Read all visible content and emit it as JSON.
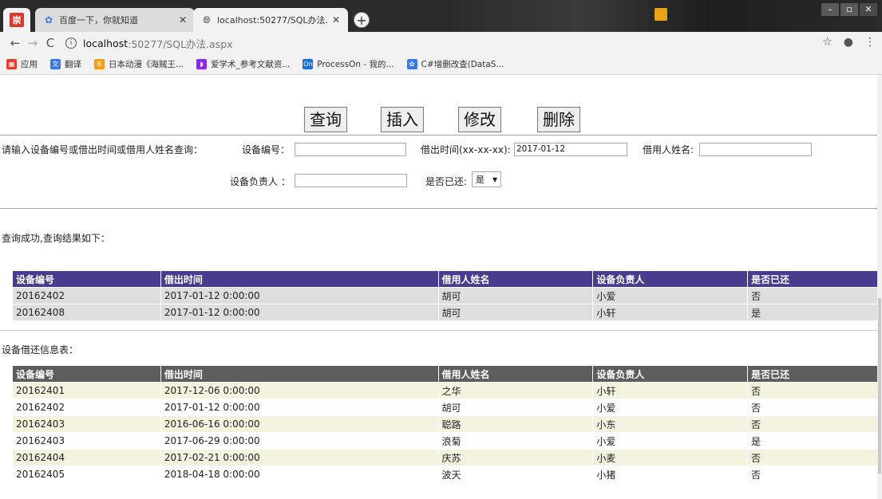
{
  "browser": {
    "ext_badge": "崇",
    "tabs": [
      {
        "title": "百度一下，你就知道",
        "favicon": "baidu-paw-icon"
      },
      {
        "title": "localhost:50277/SQL办法.aspx",
        "favicon": "globe-icon"
      }
    ],
    "address": {
      "host": "localhost",
      "path": ":50277/SQL办法.aspx"
    },
    "bookmarks": [
      {
        "label": "应用",
        "icon": "apps-grid-icon",
        "color": "#e34133"
      },
      {
        "label": "翻译",
        "icon": "translate-icon",
        "color": "#3b78e7"
      },
      {
        "label": "日本动漫《海贼王...",
        "icon": "bookmark-icon",
        "color": "#f0a020"
      },
      {
        "label": "爱学术_参考文献资...",
        "icon": "bookmark-icon",
        "color": "#8a2be2"
      },
      {
        "label": "ProcessOn - 我的...",
        "icon": "processon-icon",
        "color": "#1e6fd9"
      },
      {
        "label": "C#增删改查(DataS...",
        "icon": "baidu-paw-icon",
        "color": "#3b78e7"
      }
    ]
  },
  "actions": {
    "query": "查询",
    "insert": "插入",
    "update": "修改",
    "delete": "删除"
  },
  "form": {
    "prompt": "请输入设备编号或借出时间或借用人姓名查询：",
    "device_no_label": "设备编号：",
    "device_no_value": "",
    "borrow_time_label": "借出时间(xx-xx-xx):",
    "borrow_time_value": "2017-01-12",
    "borrower_label": "借用人姓名:",
    "borrower_value": "",
    "owner_label": "设备负责人 ：",
    "owner_value": "",
    "returned_label": "是否已还:",
    "returned_value": "是"
  },
  "result": {
    "message": "查询成功,查询结果如下：",
    "columns": [
      "设备编号",
      "借出时间",
      "借用人姓名",
      "设备负责人",
      "是否已还"
    ],
    "rows": [
      [
        "20162402",
        "2017-01-12 0:00:00",
        "胡可",
        "小爱",
        "否"
      ],
      [
        "20162408",
        "2017-01-12 0:00:00",
        "胡可",
        "小轩",
        "是"
      ]
    ]
  },
  "all_records": {
    "caption": "设备借还信息表：",
    "columns": [
      "设备编号",
      "借出时间",
      "借用人姓名",
      "设备负责人",
      "是否已还"
    ],
    "rows": [
      [
        "20162401",
        "2017-12-06 0:00:00",
        "之华",
        "小轩",
        "否"
      ],
      [
        "20162402",
        "2017-01-12 0:00:00",
        "胡可",
        "小爱",
        "否"
      ],
      [
        "20162403",
        "2016-06-16 0:00:00",
        "聪路",
        "小东",
        "否"
      ],
      [
        "20162403",
        "2017-06-29 0:00:00",
        "浪菊",
        "小爱",
        "是"
      ],
      [
        "20162404",
        "2017-02-21 0:00:00",
        "庆苏",
        "小麦",
        "否"
      ],
      [
        "20162405",
        "2018-04-18 0:00:00",
        "波天",
        "小猪",
        "否"
      ]
    ]
  }
}
